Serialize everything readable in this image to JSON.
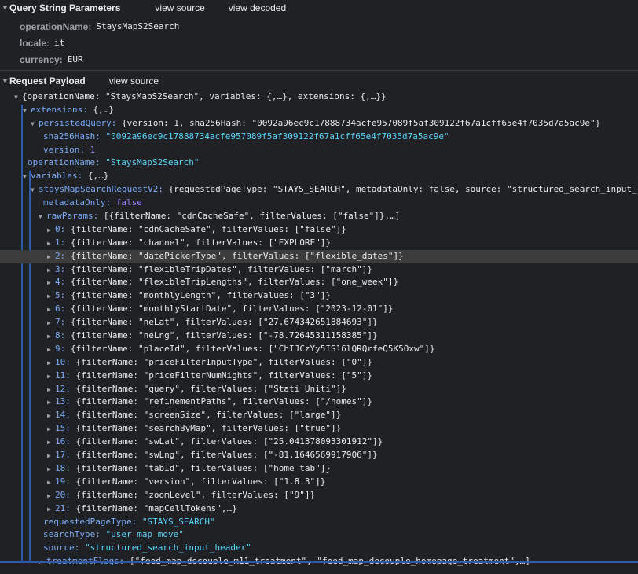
{
  "query_section": {
    "title": "Query String Parameters",
    "view_source": "view source",
    "view_decoded": "view decoded",
    "params": [
      {
        "key": "operationName:",
        "value": "StaysMapS2Search"
      },
      {
        "key": "locale:",
        "value": "it"
      },
      {
        "key": "currency:",
        "value": "EUR"
      }
    ]
  },
  "payload_section": {
    "title": "Request Payload",
    "view_source": "view source"
  },
  "tree": {
    "root_summary": "{operationName: \"StaysMapS2Search\", variables: {,…}, extensions: {,…}}",
    "extensions_key": "extensions:",
    "extensions_summary": " {,…}",
    "persisted_key": "persistedQuery:",
    "persisted_summary": " {version: 1, sha256Hash: \"0092a96ec9c17888734acfe957089f5af309122f67a1cff65e4f7035d7a5ac9e\"}",
    "sha_key": "sha256Hash:",
    "sha_value": "\"0092a96ec9c17888734acfe957089f5af309122f67a1cff65e4f7035d7a5ac9e\"",
    "version_key": "version:",
    "version_value": "1",
    "opname_key": "operationName:",
    "opname_value": "\"StaysMapS2Search\"",
    "variables_key": "variables:",
    "variables_summary": " {,…}",
    "request_key": "staysMapSearchRequestV2:",
    "request_summary": " {requestedPageType: \"STAYS_SEARCH\", metadataOnly: false, source: \"structured_search_input_",
    "metadata_key": "metadataOnly:",
    "metadata_value": "false",
    "raw_key": "rawParams:",
    "raw_summary": " [{filterName: \"cdnCacheSafe\", filterValues: [\"false\"]},…]",
    "raw_items": [
      {
        "idx": "0:",
        "text": "{filterName: \"cdnCacheSafe\", filterValues: [\"false\"]}"
      },
      {
        "idx": "1:",
        "text": "{filterName: \"channel\", filterValues: [\"EXPLORE\"]}"
      },
      {
        "idx": "2:",
        "text": "{filterName: \"datePickerType\", filterValues: [\"flexible_dates\"]}"
      },
      {
        "idx": "3:",
        "text": "{filterName: \"flexibleTripDates\", filterValues: [\"march\"]}"
      },
      {
        "idx": "4:",
        "text": "{filterName: \"flexibleTripLengths\", filterValues: [\"one_week\"]}"
      },
      {
        "idx": "5:",
        "text": "{filterName: \"monthlyLength\", filterValues: [\"3\"]}"
      },
      {
        "idx": "6:",
        "text": "{filterName: \"monthlyStartDate\", filterValues: [\"2023-12-01\"]}"
      },
      {
        "idx": "7:",
        "text": "{filterName: \"neLat\", filterValues: [\"27.674342651884693\"]}"
      },
      {
        "idx": "8:",
        "text": "{filterName: \"neLng\", filterValues: [\"-78.72645311158385\"]}"
      },
      {
        "idx": "9:",
        "text": "{filterName: \"placeId\", filterValues: [\"ChIJCzYy5IS16lQRQrfeQ5K5Oxw\"]}"
      },
      {
        "idx": "10:",
        "text": "{filterName: \"priceFilterInputType\", filterValues: [\"0\"]}"
      },
      {
        "idx": "11:",
        "text": "{filterName: \"priceFilterNumNights\", filterValues: [\"5\"]}"
      },
      {
        "idx": "12:",
        "text": "{filterName: \"query\", filterValues: [\"Stati Uniti\"]}"
      },
      {
        "idx": "13:",
        "text": "{filterName: \"refinementPaths\", filterValues: [\"/homes\"]}"
      },
      {
        "idx": "14:",
        "text": "{filterName: \"screenSize\", filterValues: [\"large\"]}"
      },
      {
        "idx": "15:",
        "text": "{filterName: \"searchByMap\", filterValues: [\"true\"]}"
      },
      {
        "idx": "16:",
        "text": "{filterName: \"swLat\", filterValues: [\"25.041378093301912\"]}"
      },
      {
        "idx": "17:",
        "text": "{filterName: \"swLng\", filterValues: [\"-81.1646569917906\"]}"
      },
      {
        "idx": "18:",
        "text": "{filterName: \"tabId\", filterValues: [\"home_tab\"]}"
      },
      {
        "idx": "19:",
        "text": "{filterName: \"version\", filterValues: [\"1.8.3\"]}"
      },
      {
        "idx": "20:",
        "text": "{filterName: \"zoomLevel\", filterValues: [\"9\"]}"
      },
      {
        "idx": "21:",
        "text": "{filterName: \"mapCellTokens\",…}"
      }
    ],
    "requested_key": "requestedPageType:",
    "requested_value": "\"STAYS_SEARCH\"",
    "searchtype_key": "searchType:",
    "searchtype_value": "\"user_map_move\"",
    "source_key": "source:",
    "source_value": "\"structured_search_input_header\"",
    "treatment_key": "treatmentFlags:",
    "treatment_summary": " [\"feed_map_decouple_m11_treatment\", \"feed_map_decouple_homepage_treatment\",…]"
  },
  "colors": {
    "background": "#202124",
    "key": "#7cacf8",
    "string": "#5cd5fb",
    "number": "#9980ff",
    "guide": "#2f5aa8"
  }
}
